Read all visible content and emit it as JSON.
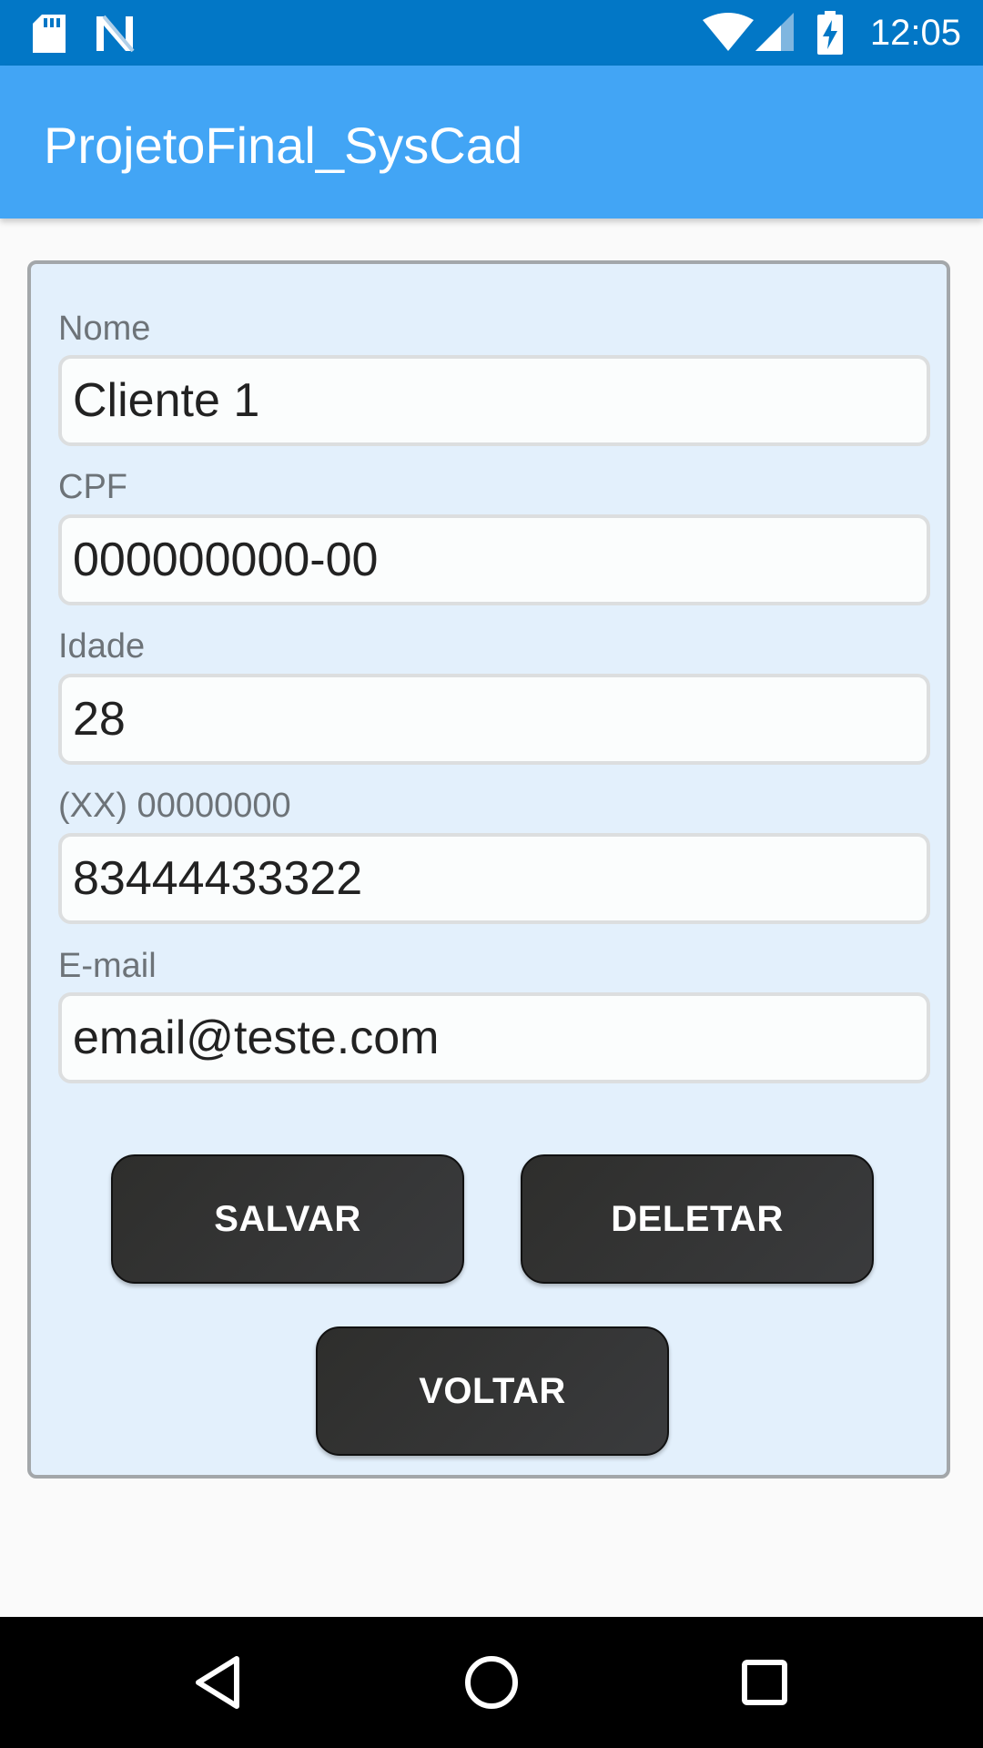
{
  "status_bar": {
    "time": "12:05",
    "icons": [
      "sd-card-icon",
      "n-notification-icon",
      "wifi-icon",
      "signal-icon",
      "battery-charging-icon"
    ]
  },
  "app_bar": {
    "title": "ProjetoFinal_SysCad"
  },
  "form": {
    "fields": [
      {
        "label": "Nome",
        "value": "Cliente 1"
      },
      {
        "label": "CPF",
        "value": "000000000-00"
      },
      {
        "label": "Idade",
        "value": "28"
      },
      {
        "label": "(XX) 00000000",
        "value": "83444433322"
      },
      {
        "label": "E-mail",
        "value": "email@teste.com"
      }
    ],
    "buttons": {
      "save": "SALVAR",
      "delete": "DELETAR",
      "back": "VOLTAR"
    }
  },
  "nav_bar": {
    "icons": [
      "back-icon",
      "home-icon",
      "recents-icon"
    ]
  },
  "colors": {
    "status_bar": "#0277c6",
    "app_bar": "#42a5f5",
    "card_background": "#e3f0fc",
    "button_background": "#333333"
  }
}
